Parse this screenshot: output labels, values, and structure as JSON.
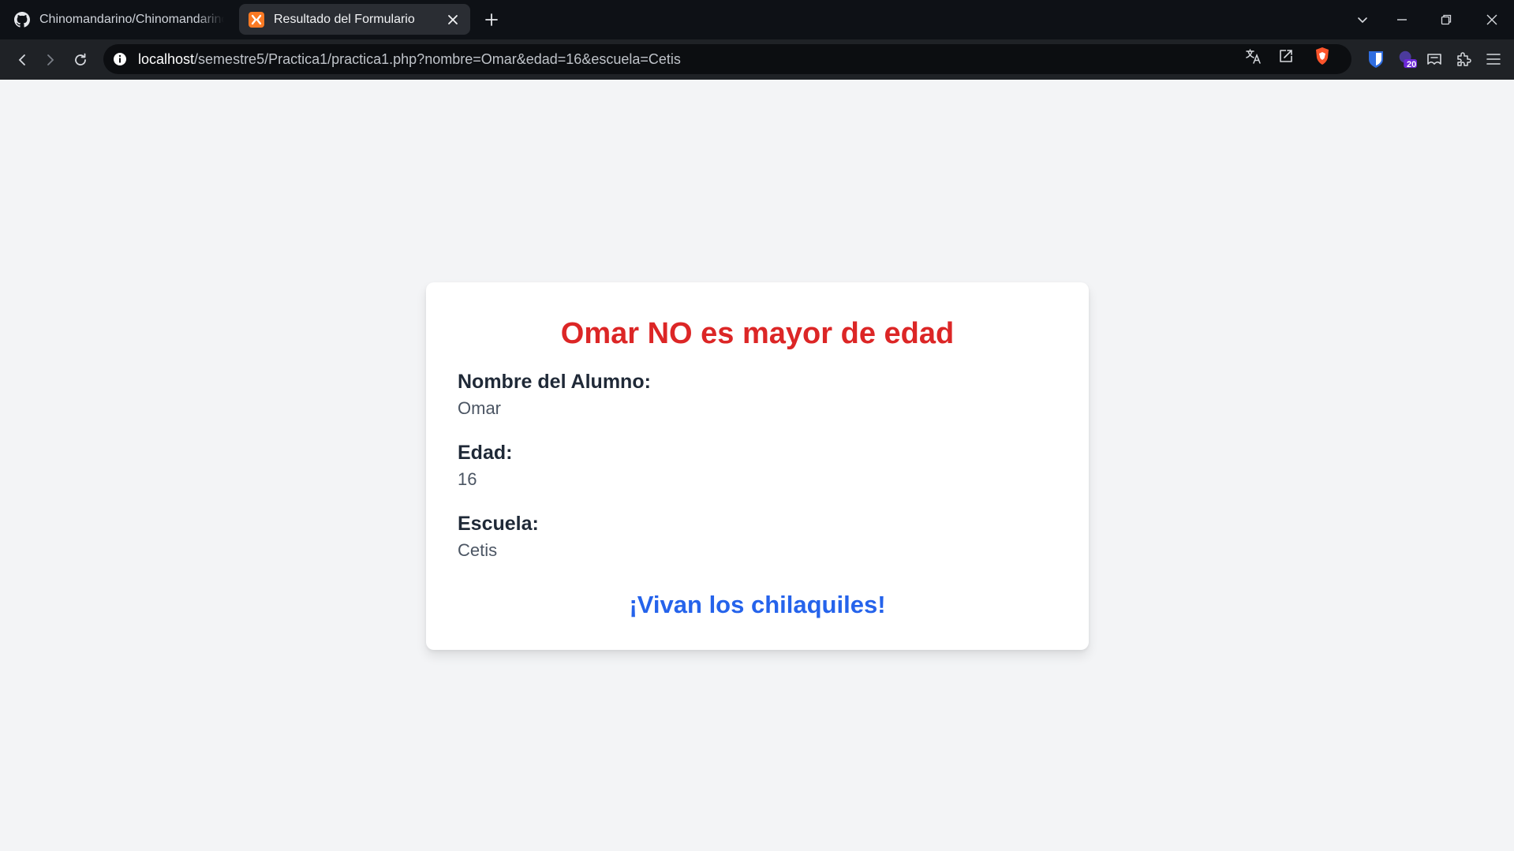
{
  "tabs": [
    {
      "title": "Chinomandarino/Chinomandarino.github.io",
      "favicon": "github-icon",
      "active": false
    },
    {
      "title": "Resultado del Formulario",
      "favicon": "xampp-icon",
      "active": true
    }
  ],
  "address_bar": {
    "host": "localhost",
    "path": "/semestre5/Practica1/practica1.php?nombre=Omar&edad=16&escuela=Cetis"
  },
  "extensions": {
    "badge_count": "20"
  },
  "card": {
    "heading": "Omar NO es mayor de edad",
    "fields": [
      {
        "label": "Nombre del Alumno:",
        "value": "Omar"
      },
      {
        "label": "Edad:",
        "value": "16"
      },
      {
        "label": "Escuela:",
        "value": "Cetis"
      }
    ],
    "footer": "¡Vivan los chilaquiles!"
  },
  "colors": {
    "heading": "#dc2626",
    "footer": "#2563eb",
    "page_background": "#f3f4f6",
    "browser_chrome": "#0e1116"
  }
}
